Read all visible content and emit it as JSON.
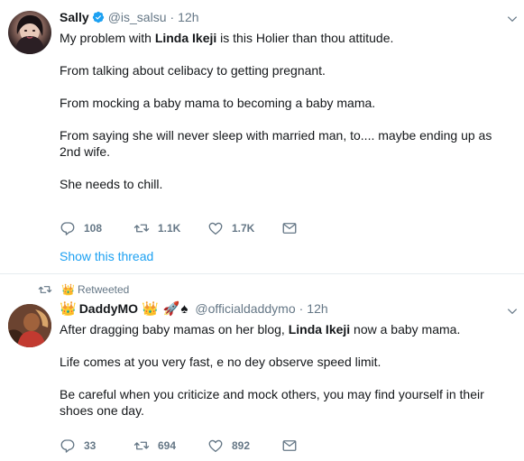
{
  "tweet1": {
    "name": "Sally",
    "handle": "@is_salsu",
    "dot": "·",
    "time": "12h",
    "p1_pre": "My problem with ",
    "p1_bold": "Linda Ikeji",
    "p1_post": " is this Holier than thou attitude.",
    "p2": "From talking about celibacy to getting pregnant.",
    "p3": "From mocking a baby mama to becoming a baby mama.",
    "p4": "From saying she will never sleep with married man, to.... maybe ending up as 2nd wife.",
    "p5": "She needs to chill.",
    "replies": "108",
    "retweets": "1.1K",
    "likes": "1.7K",
    "show_thread": "Show this thread"
  },
  "tweet2": {
    "retweeted_label": "Retweeted",
    "name": "DaddyMO",
    "handle": "@officialdaddymo",
    "dot": "·",
    "time": "12h",
    "p1_pre": "After dragging baby mamas on her blog, ",
    "p1_bold": "Linda Ikeji",
    "p1_post": " now a baby mama.",
    "p2": "Life comes at you very fast, e no dey observe speed limit.",
    "p3": "Be careful when you criticize and mock others, you may find yourself in their shoes one day.",
    "replies": "33",
    "retweets": "694",
    "likes": "892"
  },
  "colors": {
    "link": "#1da1f2",
    "muted": "#657786",
    "text": "#14171a"
  }
}
